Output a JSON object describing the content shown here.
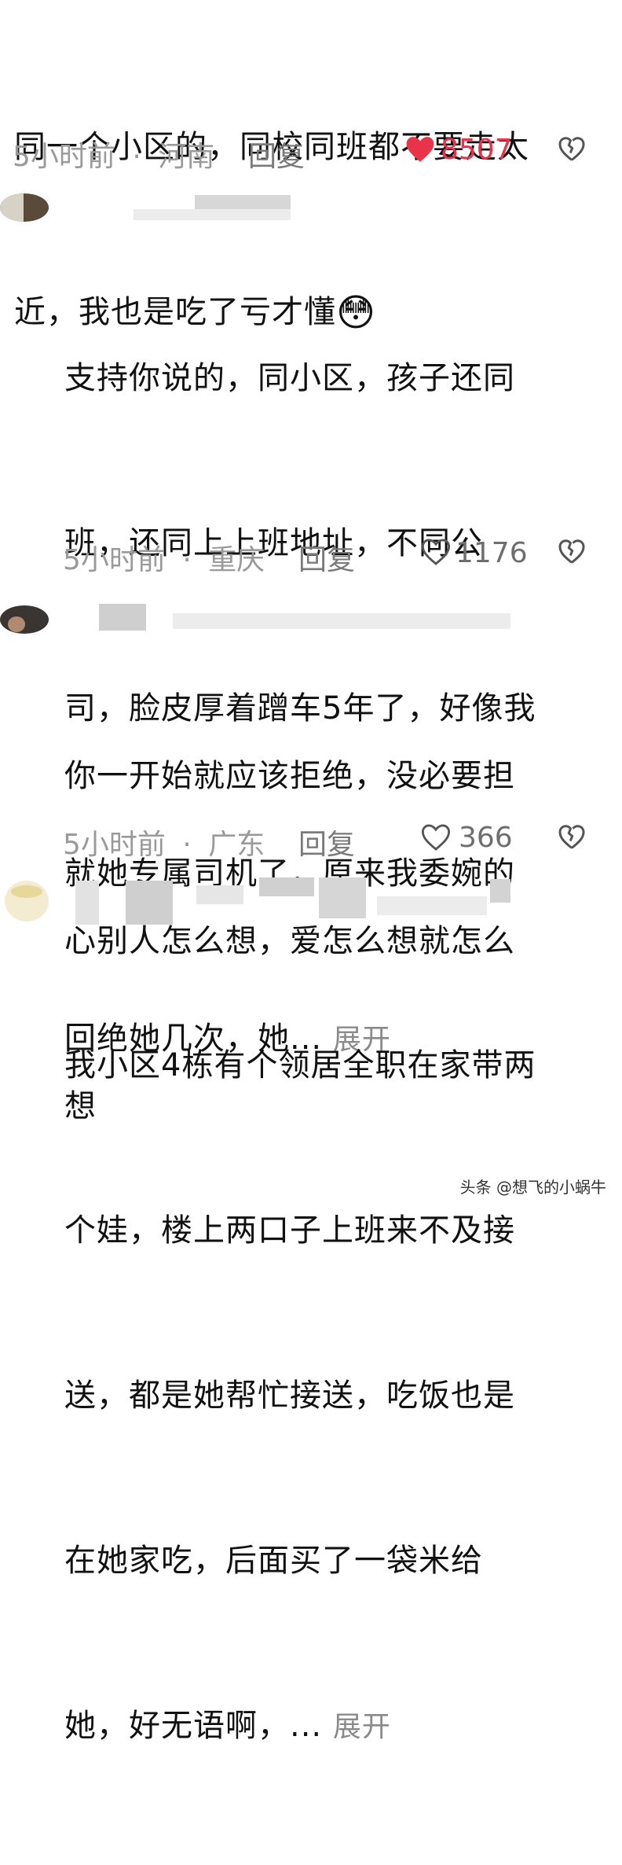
{
  "comments": [
    {
      "text_lines": [
        "同一个小区的，同校同班都不要走太",
        "近，我也是吃了亏才懂"
      ],
      "emoji": "😳",
      "time": "5小时前",
      "sep": "·",
      "location": "河南",
      "reply_label": "回复",
      "likes": "8507",
      "liked": true
    },
    {
      "text_lines": [
        "支持你说的，同小区，孩子还同",
        "班，还同上上班地址，不同公",
        "司，脸皮厚着蹭车5年了，好像我",
        "就她专属司机了，原来我委婉的",
        "回绝她几次，她..."
      ],
      "expand_label": "展开",
      "time": "5小时前",
      "sep": "·",
      "location": "重庆",
      "reply_label": "回复",
      "likes": "1176",
      "liked": false
    },
    {
      "text_lines": [
        "你一开始就应该拒绝，没必要担",
        "心别人怎么想，爱怎么想就怎么",
        "想"
      ],
      "time": "5小时前",
      "sep": "·",
      "location": "广东",
      "reply_label": "回复",
      "likes": "366",
      "liked": false
    },
    {
      "text_lines": [
        "我小区4栋有个领居全职在家带两",
        "个娃，楼上两口子上班来不及接",
        "送，都是她帮忙接送，吃饭也是",
        "在她家吃，后面买了一袋米给",
        "她，好无语啊，..."
      ],
      "expand_label": "展开",
      "watermark": "头条 @想飞的小蜗牛"
    }
  ],
  "colors": {
    "liked_red": "#e8334a",
    "meta_gray": "#9a9a9a"
  },
  "icons": [
    "heart-filled-icon",
    "heart-outline-icon",
    "broken-heart-icon",
    "avatar"
  ]
}
